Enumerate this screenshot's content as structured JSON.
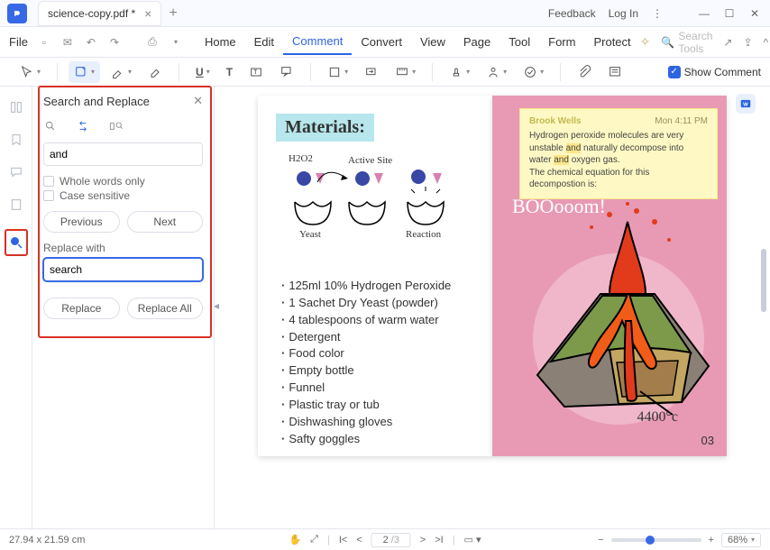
{
  "titlebar": {
    "tab_title": "science-copy.pdf *",
    "feedback": "Feedback",
    "login": "Log In"
  },
  "menubar": {
    "file": "File",
    "items": [
      "Home",
      "Edit",
      "Comment",
      "Convert",
      "View",
      "Page",
      "Tool",
      "Form",
      "Protect"
    ],
    "active_index": 2,
    "search_tools_placeholder": "Search Tools"
  },
  "toolbar": {
    "show_comment_label": "Show Comment"
  },
  "panel": {
    "title": "Search and Replace",
    "search_value": "and",
    "whole_words": "Whole words only",
    "case_sensitive": "Case sensitive",
    "prev": "Previous",
    "next": "Next",
    "replace_with_label": "Replace with",
    "replace_value": "search",
    "replace": "Replace",
    "replace_all": "Replace All"
  },
  "doc": {
    "materials_header": "Materials:",
    "h2o2": "H2O2",
    "active_site": "Active Site",
    "yeast": "Yeast",
    "reaction": "Reaction",
    "list": [
      "125ml 10% Hydrogen Peroxide",
      "1 Sachet Dry Yeast (powder)",
      "4 tablespoons of warm water",
      "Detergent",
      "Food color",
      "Empty bottle",
      "Funnel",
      "Plastic tray or tub",
      "Dishwashing gloves",
      "Safty goggles"
    ],
    "sticky": {
      "author": "Brook Wells",
      "time": "Mon 4:11 PM",
      "line1a": "Hydrogen peroxide molecules are very unstable ",
      "line1b": "and",
      "line2a": " naturally decompose into water ",
      "line2b": "and",
      "line2c": " oxygen gas.",
      "line3": "The chemical equation for this decompostion is:"
    },
    "boom": "BOOooom!",
    "temp": "4400°c",
    "page_num": "03"
  },
  "statusbar": {
    "dimensions": "27.94 x 21.59 cm",
    "page_current": "2",
    "page_total": "/3",
    "zoom": "68%"
  }
}
